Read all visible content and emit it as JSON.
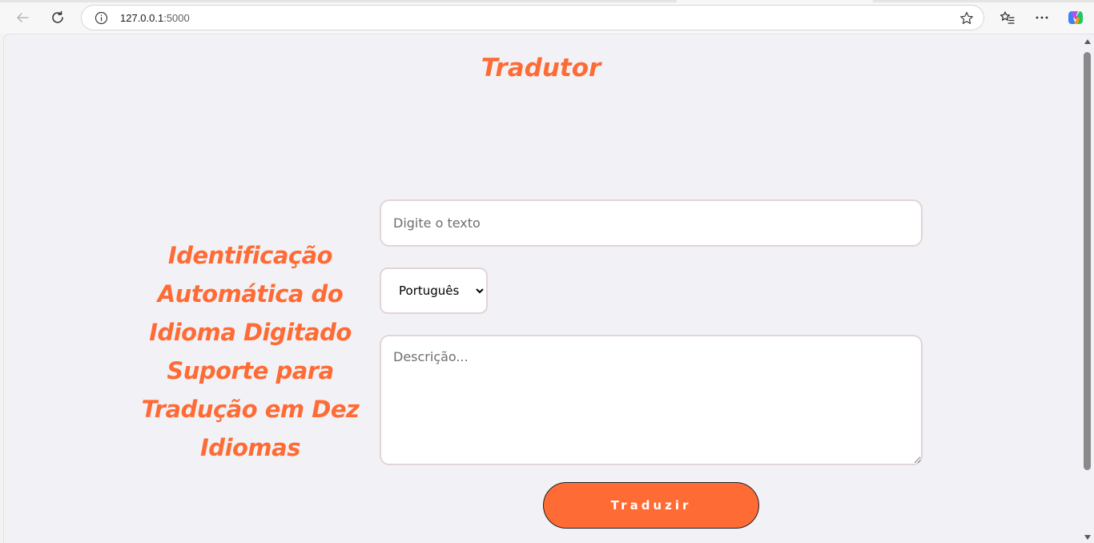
{
  "browser": {
    "url_host": "127.0.0.1",
    "url_port": ":5000",
    "icons": {
      "back": "back-arrow-icon",
      "reload": "reload-icon",
      "info": "info-icon",
      "star": "star-icon",
      "favorites": "favorites-icon",
      "more": "more-icon",
      "copilot": "copilot-icon"
    }
  },
  "page": {
    "title": "Tradutor",
    "features": [
      "Identificação",
      "Automática do",
      "Idioma Digitado",
      "Suporte para",
      "Tradução em Dez",
      "Idiomas"
    ],
    "text_input": {
      "placeholder": "Digite o texto",
      "value": ""
    },
    "language_select": {
      "selected": "Português"
    },
    "description": {
      "placeholder": "Descrição...",
      "value": ""
    },
    "translate_button": "Traduzir"
  },
  "colors": {
    "accent": "#ff6b35",
    "background": "#f2f2f6",
    "field_border": "#e3d4d6"
  }
}
